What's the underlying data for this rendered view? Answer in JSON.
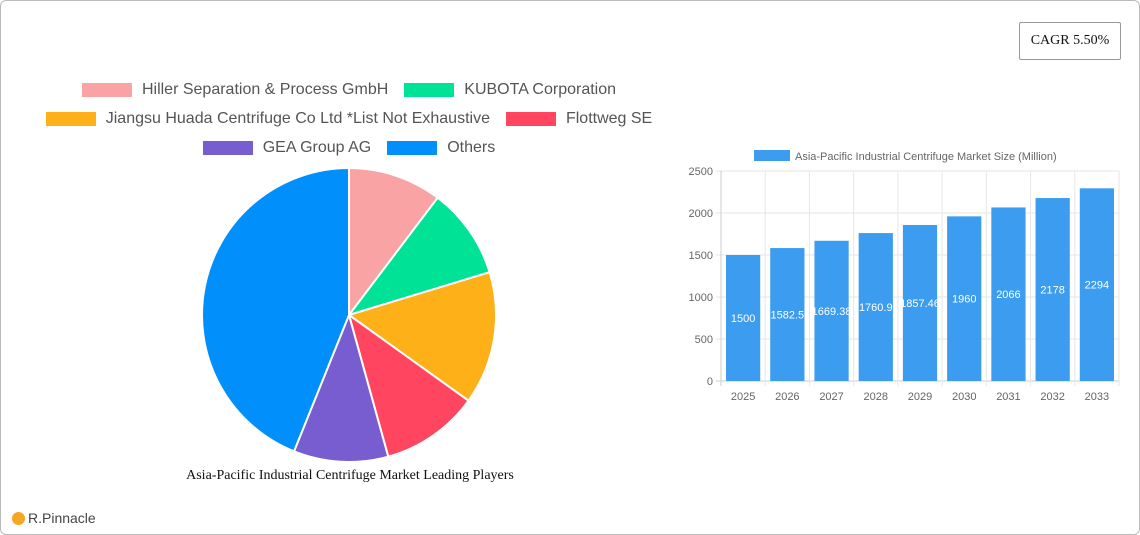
{
  "cagr_label": "CAGR 5.50%",
  "brand": "R.Pinnacle",
  "chart_data": [
    {
      "type": "pie",
      "title": "Asia-Pacific Industrial Centrifuge Market Leading Players",
      "legend_position": "top",
      "labels": [
        "Hiller Separation & Process GmbH",
        "KUBOTA Corporation",
        "Jiangsu Huada Centrifuge Co  Ltd *List Not Exhaustive",
        "Flottweg SE",
        "GEA Group AG",
        "Others"
      ],
      "values": [
        10.3,
        10.0,
        14.6,
        10.8,
        10.4,
        43.9
      ],
      "colors": [
        "#f9a3a4",
        "#00e396",
        "#feb019",
        "#ff4560",
        "#775dd0",
        "#008ffb"
      ]
    },
    {
      "type": "bar",
      "legend": "Asia-Pacific Industrial Centrifuge Market Size (Million)",
      "legend_position": "top",
      "categories": [
        "2025",
        "2026",
        "2027",
        "2028",
        "2029",
        "2030",
        "2031",
        "2032",
        "2033"
      ],
      "values": [
        1500,
        1582.5,
        1669.38,
        1760.9,
        1857.46,
        1960,
        2066,
        2178,
        2294
      ],
      "ylim": [
        0,
        2500
      ],
      "yticks": [
        0,
        500,
        1000,
        1500,
        2000,
        2500
      ],
      "grid": true,
      "color": "#3b9cf0"
    }
  ]
}
